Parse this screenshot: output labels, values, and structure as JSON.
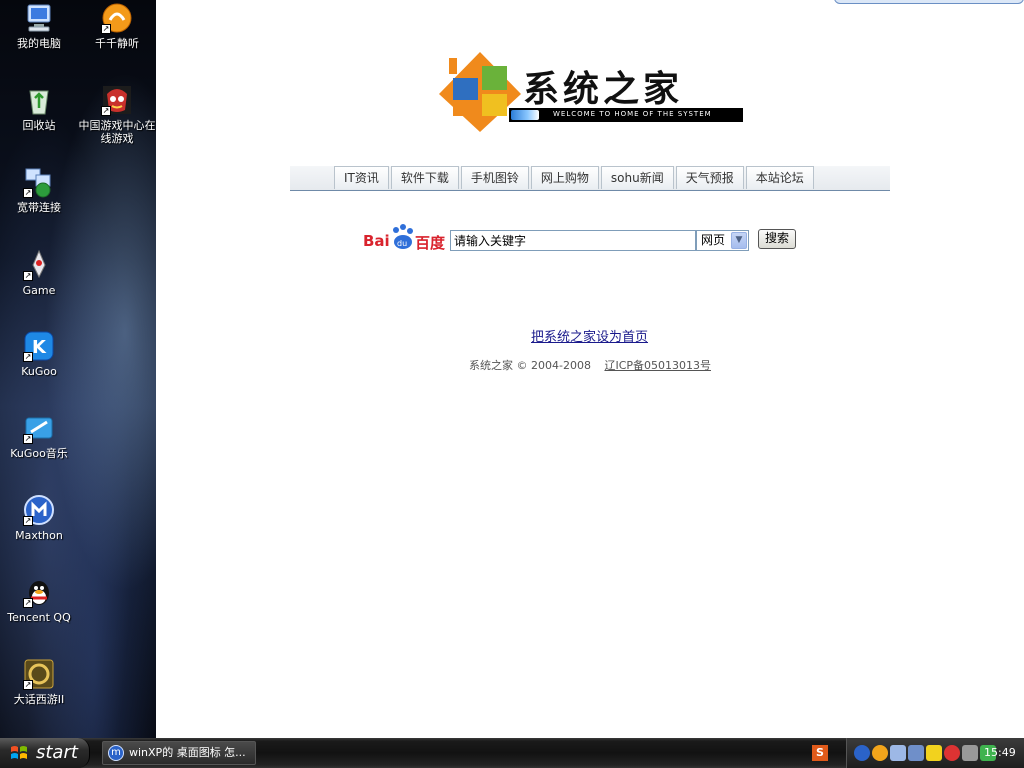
{
  "desktop": {
    "icons": [
      {
        "label": "我的电脑",
        "icon": "my-computer-icon"
      },
      {
        "label": "千千静听",
        "icon": "ttplayer-icon"
      },
      {
        "label": "回收站",
        "icon": "recycle-bin-icon"
      },
      {
        "label": "中国游戏中心在线游戏",
        "icon": "game-center-icon"
      },
      {
        "label": "宽带连接",
        "icon": "broadband-connection-icon"
      },
      {
        "label": "Game",
        "icon": "game-icon"
      },
      {
        "label": "KuGoo",
        "icon": "kugoo-icon"
      },
      {
        "label": "KuGoo音乐",
        "icon": "kugoo-music-icon"
      },
      {
        "label": "Maxthon",
        "icon": "maxthon-icon"
      },
      {
        "label": "Tencent QQ",
        "icon": "qq-icon"
      },
      {
        "label": "大话西游II",
        "icon": "dahua-xiyou-icon"
      }
    ]
  },
  "logo": {
    "title": "系统之家",
    "tagline": "WELCOME TO HOME OF THE SYSTEM"
  },
  "nav": {
    "tabs": [
      "IT资讯",
      "软件下载",
      "手机图铃",
      "网上购物",
      "sohu新闻",
      "天气预报",
      "本站论坛"
    ]
  },
  "search": {
    "brand": "Bai百度",
    "brand_left": "Bai",
    "brand_right": "百度",
    "placeholder": "请输入关键字",
    "value": "请输入关键字",
    "category": "网页",
    "button": "搜索"
  },
  "links": {
    "set_home": "把系统之家设为首页"
  },
  "footer": {
    "copyright": "系统之家 © 2004-2008",
    "icp": "辽ICP备05013013号"
  },
  "taskbar": {
    "start": "start",
    "task": "winXP的 桌面图标 怎...",
    "ime": "S",
    "clock": "15:49"
  },
  "colors": {
    "accent": "#d9232d",
    "link": "#1a1a8c",
    "nav_border": "#6f8aa8"
  }
}
